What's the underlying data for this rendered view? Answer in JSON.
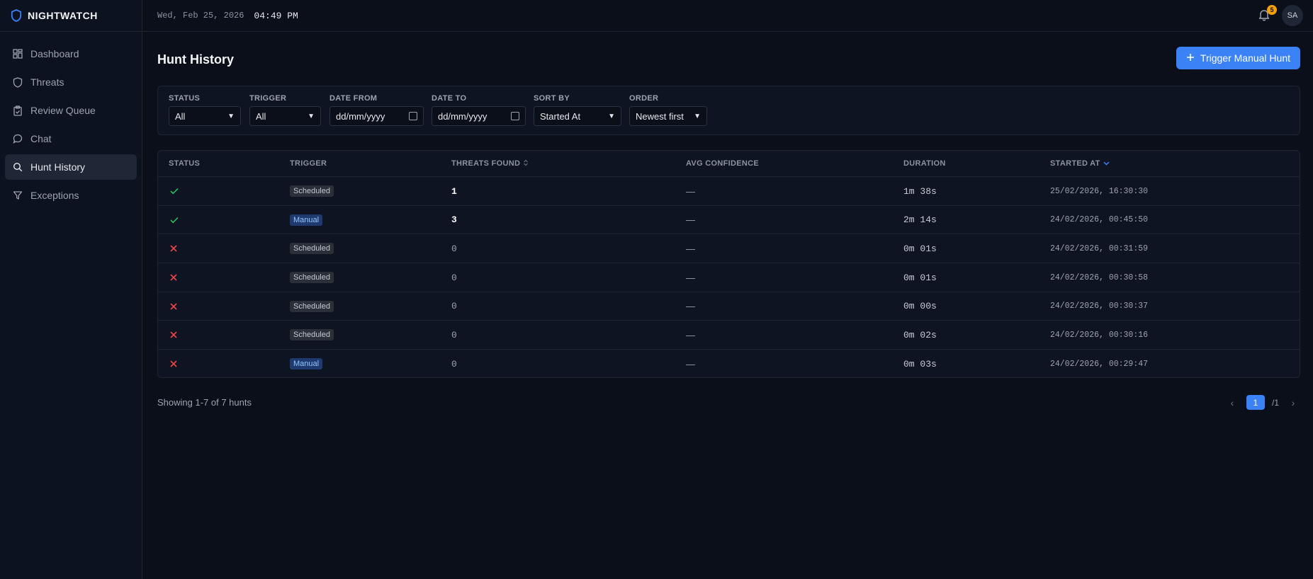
{
  "app": {
    "name": "NIGHTWATCH"
  },
  "sidebar": {
    "items": [
      {
        "label": "Dashboard",
        "icon": "dashboard-icon",
        "active": false
      },
      {
        "label": "Threats",
        "icon": "shield-icon",
        "active": false
      },
      {
        "label": "Review Queue",
        "icon": "clipboard-icon",
        "active": false
      },
      {
        "label": "Chat",
        "icon": "chat-icon",
        "active": false
      },
      {
        "label": "Hunt History",
        "icon": "search-icon",
        "active": true
      },
      {
        "label": "Exceptions",
        "icon": "filter-icon",
        "active": false
      }
    ]
  },
  "topbar": {
    "date": "Wed, Feb 25, 2026",
    "time": "04:49 PM",
    "notifications": "5",
    "user_initials": "SA"
  },
  "page": {
    "title": "Hunt History",
    "trigger_button": "Trigger Manual Hunt"
  },
  "filters": {
    "status": {
      "label": "STATUS",
      "value": "All"
    },
    "trigger": {
      "label": "TRIGGER",
      "value": "All"
    },
    "date_from": {
      "label": "DATE FROM",
      "value": "dd/mm/yyyy"
    },
    "date_to": {
      "label": "DATE TO",
      "value": "dd/mm/yyyy"
    },
    "sort_by": {
      "label": "SORT BY",
      "value": "Started At"
    },
    "order": {
      "label": "ORDER",
      "value": "Newest first"
    }
  },
  "table": {
    "headers": {
      "status": "STATUS",
      "trigger": "TRIGGER",
      "threats_found": "THREATS FOUND",
      "avg_confidence": "AVG CONFIDENCE",
      "duration": "DURATION",
      "started_at": "STARTED AT"
    },
    "rows": [
      {
        "status": "success",
        "trigger": "Scheduled",
        "threats": "1",
        "confidence": "—",
        "duration": "1m 38s",
        "started": "25/02/2026, 16:30:30"
      },
      {
        "status": "success",
        "trigger": "Manual",
        "threats": "3",
        "confidence": "—",
        "duration": "2m 14s",
        "started": "24/02/2026, 00:45:50"
      },
      {
        "status": "failed",
        "trigger": "Scheduled",
        "threats": "0",
        "confidence": "—",
        "duration": "0m 01s",
        "started": "24/02/2026, 00:31:59"
      },
      {
        "status": "failed",
        "trigger": "Scheduled",
        "threats": "0",
        "confidence": "—",
        "duration": "0m 01s",
        "started": "24/02/2026, 00:30:58"
      },
      {
        "status": "failed",
        "trigger": "Scheduled",
        "threats": "0",
        "confidence": "—",
        "duration": "0m 00s",
        "started": "24/02/2026, 00:30:37"
      },
      {
        "status": "failed",
        "trigger": "Scheduled",
        "threats": "0",
        "confidence": "—",
        "duration": "0m 02s",
        "started": "24/02/2026, 00:30:16"
      },
      {
        "status": "failed",
        "trigger": "Manual",
        "threats": "0",
        "confidence": "—",
        "duration": "0m 03s",
        "started": "24/02/2026, 00:29:47"
      }
    ]
  },
  "footer": {
    "summary": "Showing 1-7 of 7 hunts",
    "current_page": "1",
    "total_pages": "/1"
  },
  "colors": {
    "accent": "#3b82f6",
    "success": "#22c55e",
    "failure": "#ef4444",
    "badge": "#f59e0b"
  }
}
